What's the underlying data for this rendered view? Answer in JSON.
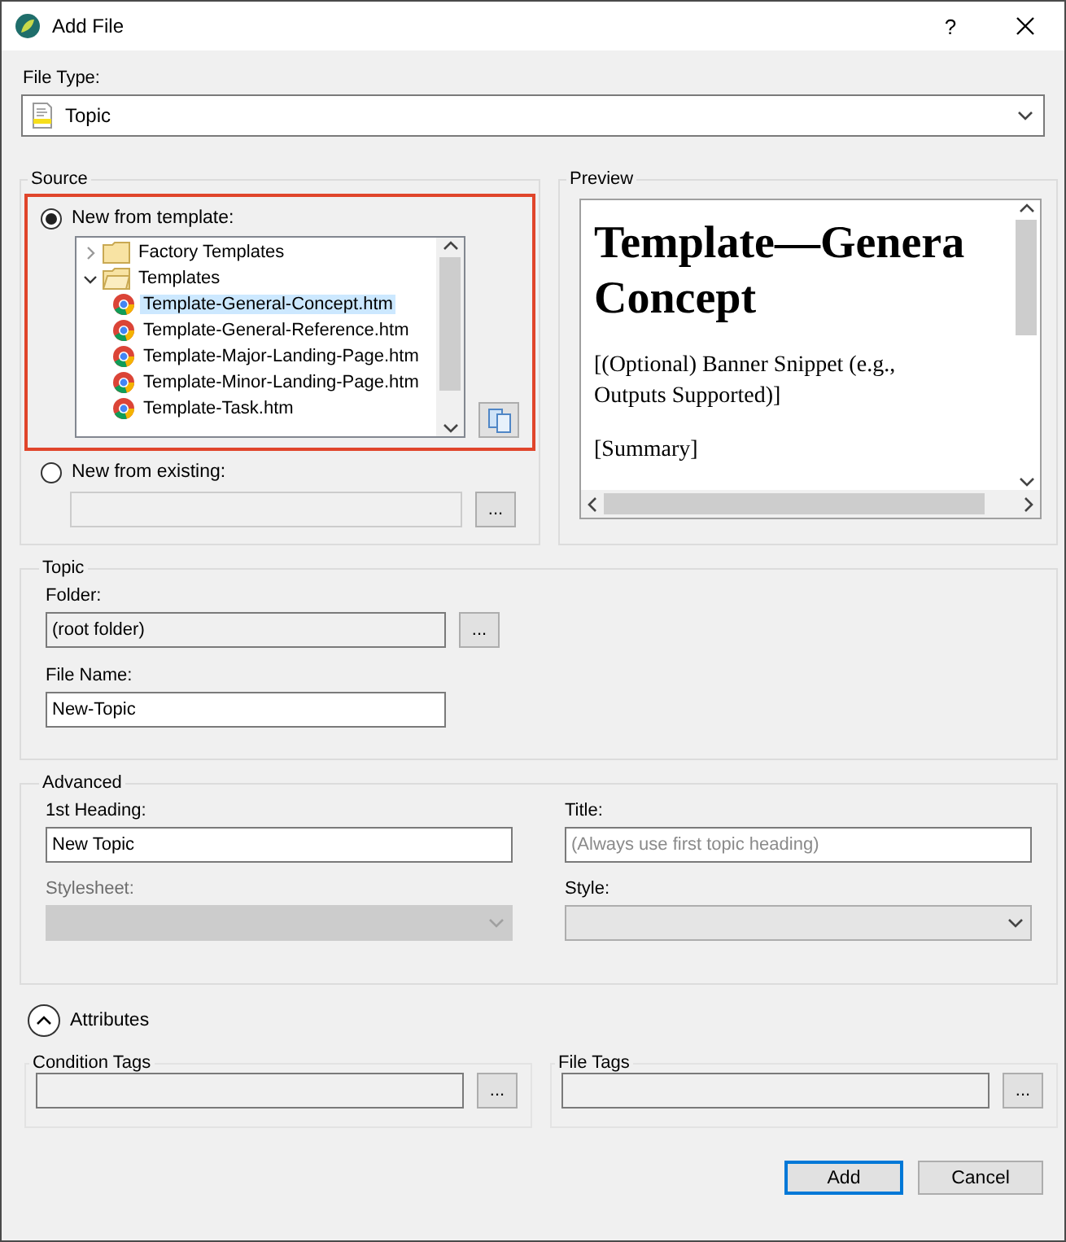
{
  "window": {
    "title": "Add File",
    "help": "?"
  },
  "file_type": {
    "label": "File Type:",
    "value": "Topic"
  },
  "source": {
    "title": "Source",
    "options": [
      {
        "label": "New from template:",
        "selected": true
      },
      {
        "label": "New from existing:",
        "selected": false
      }
    ],
    "tree": [
      {
        "label": "Factory Templates",
        "kind": "folder",
        "expanded": false
      },
      {
        "label": "Templates",
        "kind": "folder",
        "expanded": true,
        "children": [
          {
            "label": "Template-General-Concept.htm",
            "kind": "file",
            "selected": true
          },
          {
            "label": "Template-General-Reference.htm",
            "kind": "file",
            "selected": false
          },
          {
            "label": "Template-Major-Landing-Page.htm",
            "kind": "file",
            "selected": false
          },
          {
            "label": "Template-Minor-Landing-Page.htm",
            "kind": "file",
            "selected": false
          },
          {
            "label": "Template-Task.htm",
            "kind": "file",
            "selected": false
          }
        ]
      }
    ],
    "browse_label": "..."
  },
  "preview": {
    "title": "Preview",
    "heading": [
      "Template—Genera",
      "Concept"
    ],
    "paragraphs": [
      "[(Optional) Banner Snippet (e.g., Outputs Supported)]",
      "[Summary]"
    ]
  },
  "topic": {
    "title": "Topic",
    "folder": {
      "label": "Folder:",
      "value": "(root folder)",
      "button": "..."
    },
    "file_name": {
      "label": "File Name:",
      "value": "New-Topic"
    }
  },
  "advanced": {
    "title": "Advanced",
    "first_heading": {
      "label": "1st Heading:",
      "value": "New Topic"
    },
    "title_field": {
      "label": "Title:",
      "placeholder": "(Always use first topic heading)"
    },
    "stylesheet": {
      "label": "Stylesheet:",
      "disabled": true
    },
    "style": {
      "label": "Style:",
      "disabled": false
    }
  },
  "attributes": {
    "label": "Attributes",
    "expanded": true
  },
  "condition_tags": {
    "title": "Condition Tags",
    "button": "..."
  },
  "file_tags": {
    "title": "File Tags",
    "button": "..."
  },
  "buttons": [
    {
      "label": "Add",
      "default": true
    },
    {
      "label": "Cancel",
      "default": false
    }
  ]
}
